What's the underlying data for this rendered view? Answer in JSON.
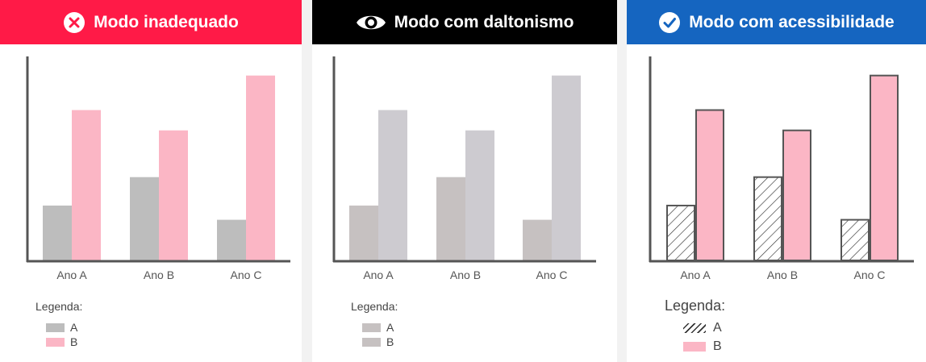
{
  "panels": [
    {
      "title": "Modo inadequado",
      "icon": "x-circle-icon",
      "header_color": "#ff1a47",
      "legend_title": "Legenda:",
      "legend": [
        "A",
        "B"
      ],
      "colors": {
        "A": "#bdbdbd",
        "B": "#fbb6c5"
      },
      "style": "flat"
    },
    {
      "title": "Modo com daltonismo",
      "icon": "eye-icon",
      "header_color": "#000000",
      "legend_title": "Legenda:",
      "legend": [
        "A",
        "B"
      ],
      "colors": {
        "A": "#c6c1c1",
        "B": "#cdcbd0"
      },
      "style": "flat"
    },
    {
      "title": "Modo com acessibilidade",
      "icon": "check-circle-icon",
      "header_color": "#1565c0",
      "legend_title": "Legenda:",
      "legend": [
        "A",
        "B"
      ],
      "colors": {
        "A": "#ffffff",
        "B": "#fbb6c5"
      },
      "style": "hatched"
    }
  ],
  "chart_data": [
    {
      "type": "bar",
      "categories": [
        "Ano A",
        "Ano B",
        "Ano C"
      ],
      "series": [
        {
          "name": "A",
          "values": [
            27,
            41,
            20
          ]
        },
        {
          "name": "B",
          "values": [
            74,
            64,
            91
          ]
        }
      ],
      "ylim": [
        0,
        100
      ],
      "grid": false
    },
    {
      "type": "bar",
      "categories": [
        "Ano A",
        "Ano B",
        "Ano C"
      ],
      "series": [
        {
          "name": "A",
          "values": [
            27,
            41,
            20
          ]
        },
        {
          "name": "B",
          "values": [
            74,
            64,
            91
          ]
        }
      ],
      "ylim": [
        0,
        100
      ],
      "grid": false
    },
    {
      "type": "bar",
      "categories": [
        "Ano A",
        "Ano B",
        "Ano C"
      ],
      "series": [
        {
          "name": "A",
          "values": [
            27,
            41,
            20
          ]
        },
        {
          "name": "B",
          "values": [
            74,
            64,
            91
          ]
        }
      ],
      "ylim": [
        0,
        100
      ],
      "grid": false
    }
  ]
}
